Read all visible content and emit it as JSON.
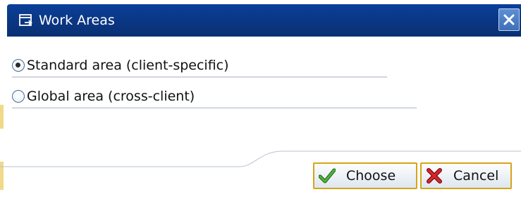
{
  "window": {
    "title": "Work Areas"
  },
  "options": [
    {
      "label": "Standard area (client-specific)",
      "selected": true
    },
    {
      "label": "Global area (cross-client)",
      "selected": false
    }
  ],
  "buttons": {
    "choose_label": "Choose",
    "cancel_label": "Cancel"
  },
  "icons": {
    "title": "window-icon",
    "close": "close-icon",
    "choose": "checkmark-icon",
    "cancel": "cross-icon"
  },
  "colors": {
    "titlebar": "#0a3682",
    "button_border": "#d6a418",
    "check_green": "#2f8a1e",
    "cancel_red": "#c8141a"
  }
}
